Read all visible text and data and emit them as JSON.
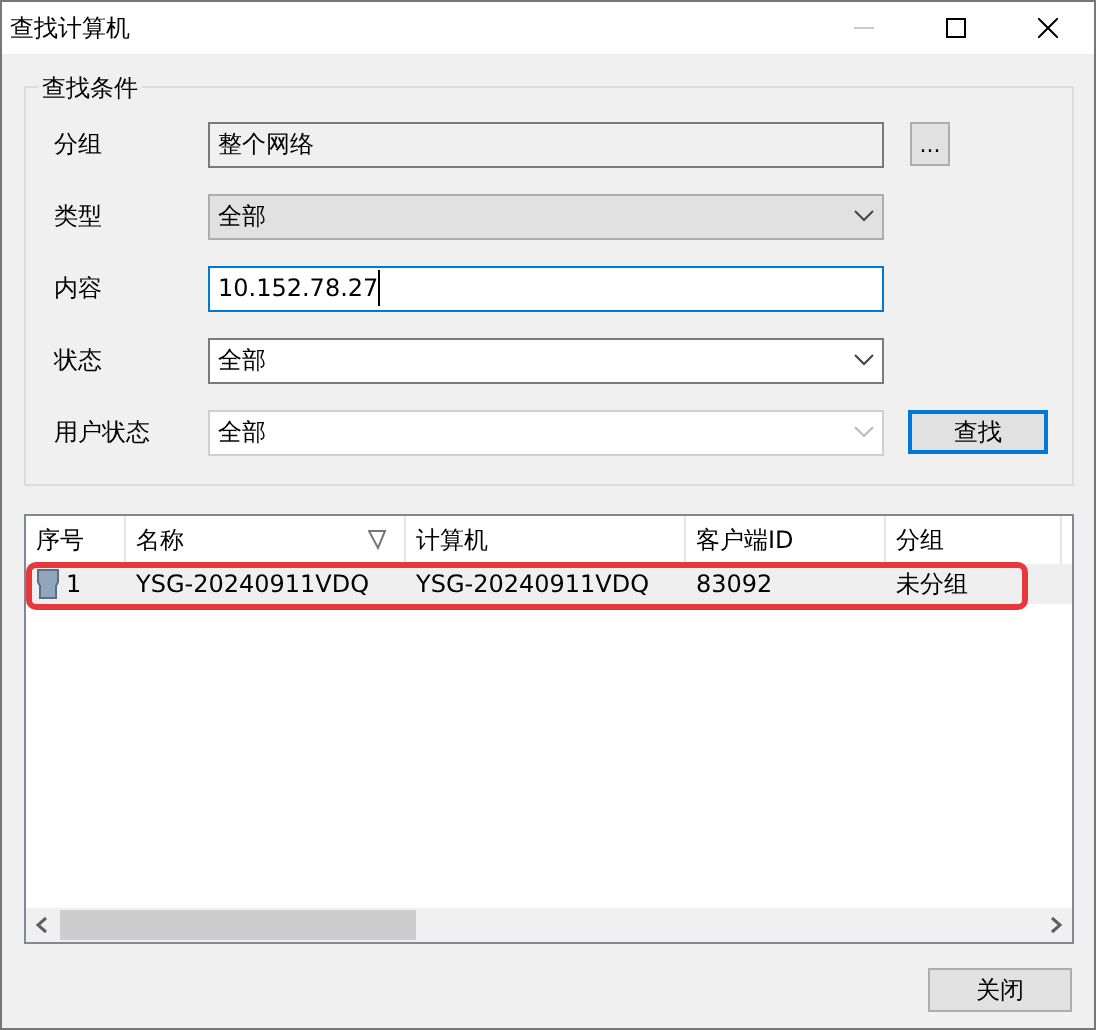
{
  "window": {
    "title": "查找计算机"
  },
  "criteria": {
    "title": "查找条件",
    "fields": [
      {
        "label": "分组",
        "kind": "readonly",
        "value": "整个网络",
        "browse_button": "..."
      },
      {
        "label": "类型",
        "kind": "combo",
        "value": "全部",
        "disabled": true
      },
      {
        "label": "内容",
        "kind": "text",
        "value": "10.152.78.27",
        "focused": true
      },
      {
        "label": "状态",
        "kind": "combo",
        "value": "全部",
        "disabled": false
      },
      {
        "label": "用户状态",
        "kind": "combo",
        "value": "全部",
        "disabled": true
      }
    ],
    "search_button": "查找"
  },
  "table": {
    "columns": [
      {
        "label": "序号",
        "filter": false
      },
      {
        "label": "名称",
        "filter": true
      },
      {
        "label": "计算机",
        "filter": false
      },
      {
        "label": "客户端ID",
        "filter": false
      },
      {
        "label": "分组",
        "filter": false
      }
    ],
    "rows": [
      {
        "cells": [
          "1",
          "YSG-20240911VDQ",
          "YSG-20240911VDQ",
          "83092",
          "未分组"
        ],
        "selected": true,
        "highlighted": true
      }
    ]
  },
  "close_button": "关闭"
}
